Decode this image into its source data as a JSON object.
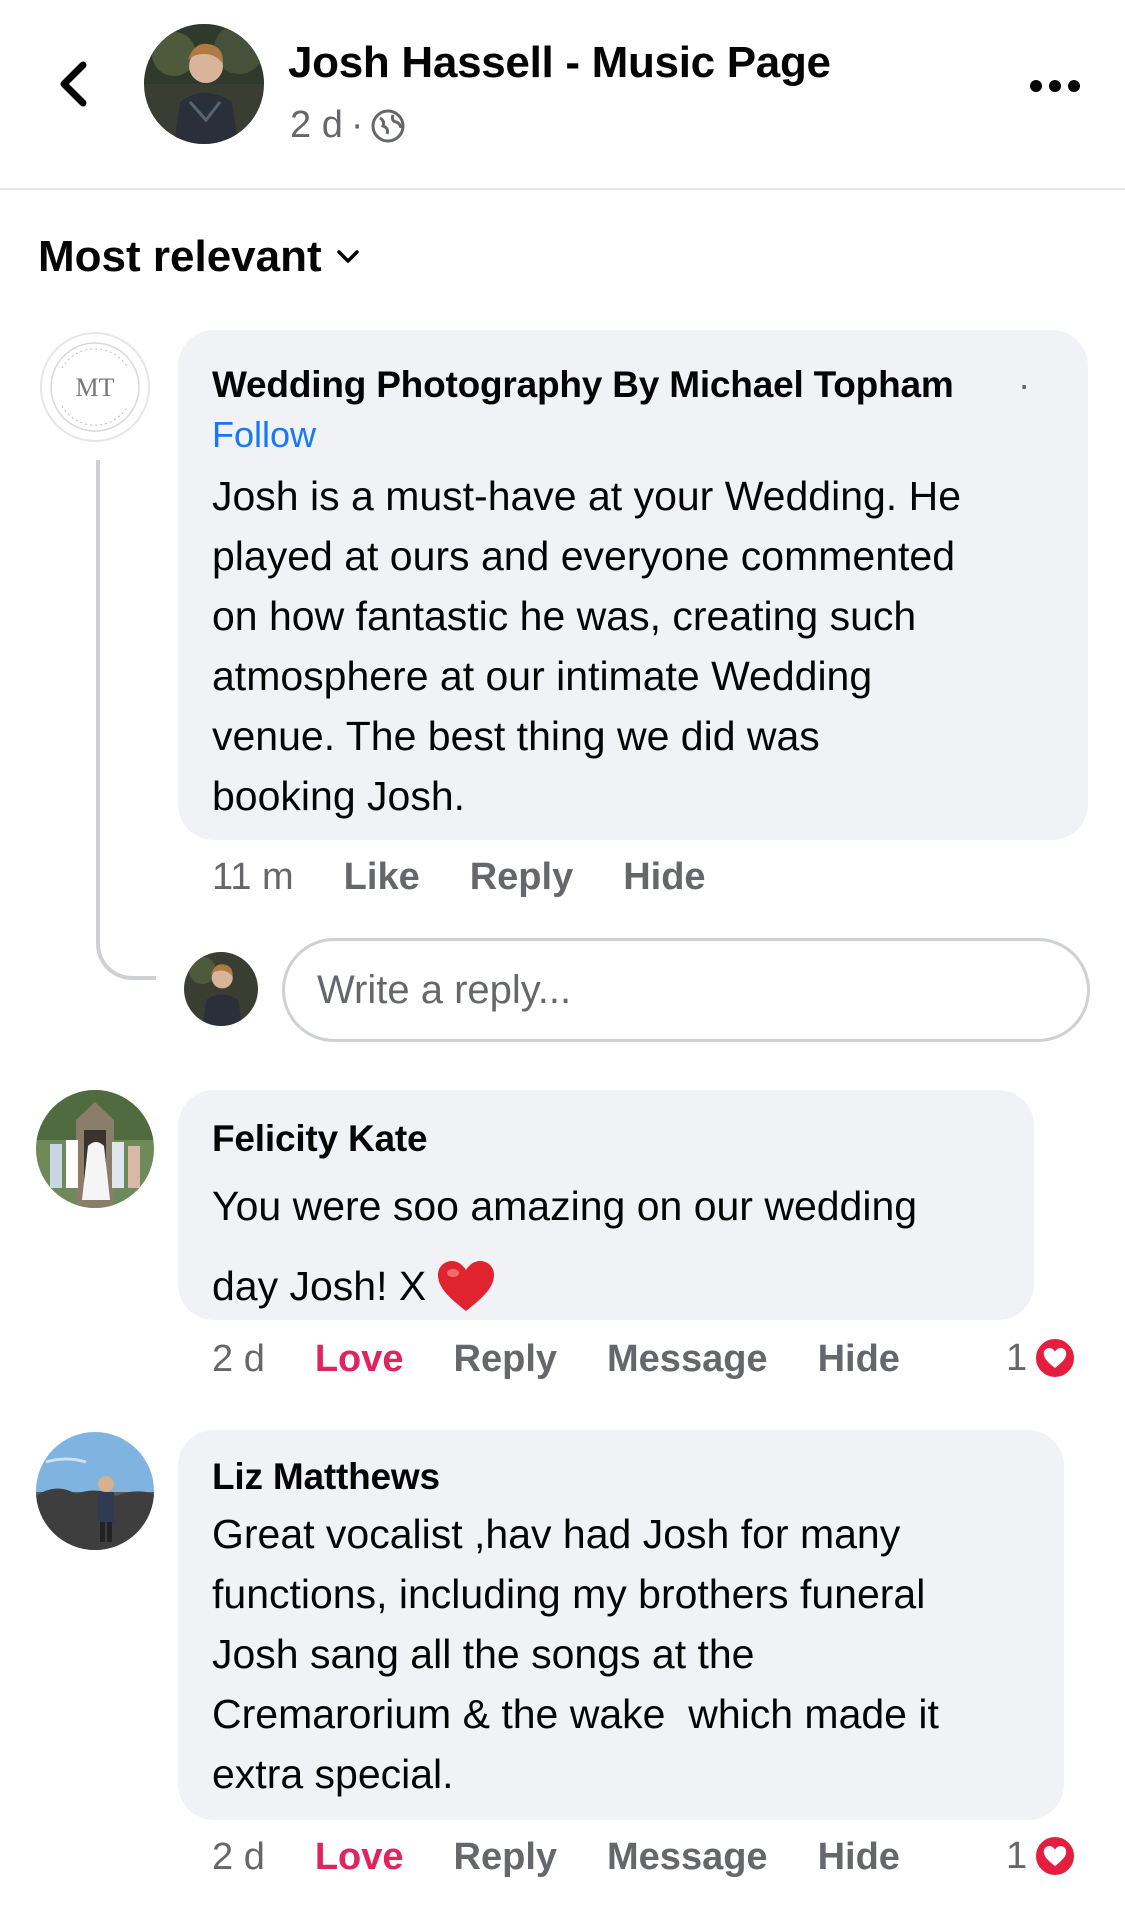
{
  "header": {
    "title": "Josh Hassell - Music Page",
    "time": "2 d",
    "separator": "·",
    "icons": {
      "back": "chevron-left-icon",
      "globe": "globe-icon",
      "more": "more-horizontal-icon"
    }
  },
  "sort": {
    "label": "Most relevant"
  },
  "comments": [
    {
      "author": "Wedding Photography By Michael Topham",
      "dot": "·",
      "follow": "Follow",
      "avatar_text": "MT",
      "text_lines": [
        "Josh is a must-have at your Wedding. He",
        "played at ours and everyone commented",
        "on how fantastic he was, creating such",
        "atmosphere at our intimate Wedding",
        "venue. The best thing we did was",
        "booking Josh."
      ],
      "time": "11 m",
      "actions": [
        "Like",
        "Reply",
        "Hide"
      ]
    },
    {
      "author": "Felicity Kate",
      "text_lines": [
        "You were soo amazing on our wedding",
        "day Josh! X"
      ],
      "time": "2 d",
      "actions": [
        "Love",
        "Reply",
        "Message",
        "Hide"
      ],
      "reaction_count": "1"
    },
    {
      "author": "Liz Matthews",
      "text_lines": [
        "Great vocalist ,hav had Josh for many",
        "functions, including my brothers funeral",
        "Josh sang all the songs at the",
        "Cremarorium & the wake  which made it",
        "extra special."
      ],
      "time": "2 d",
      "actions": [
        "Love",
        "Reply",
        "Message",
        "Hide"
      ],
      "reaction_count": "1"
    }
  ],
  "reply_box": {
    "placeholder": "Write a reply..."
  },
  "colors": {
    "link": "#1877f2",
    "love": "#e0245e",
    "bubble": "#f0f2f5",
    "muted": "#65676b"
  }
}
